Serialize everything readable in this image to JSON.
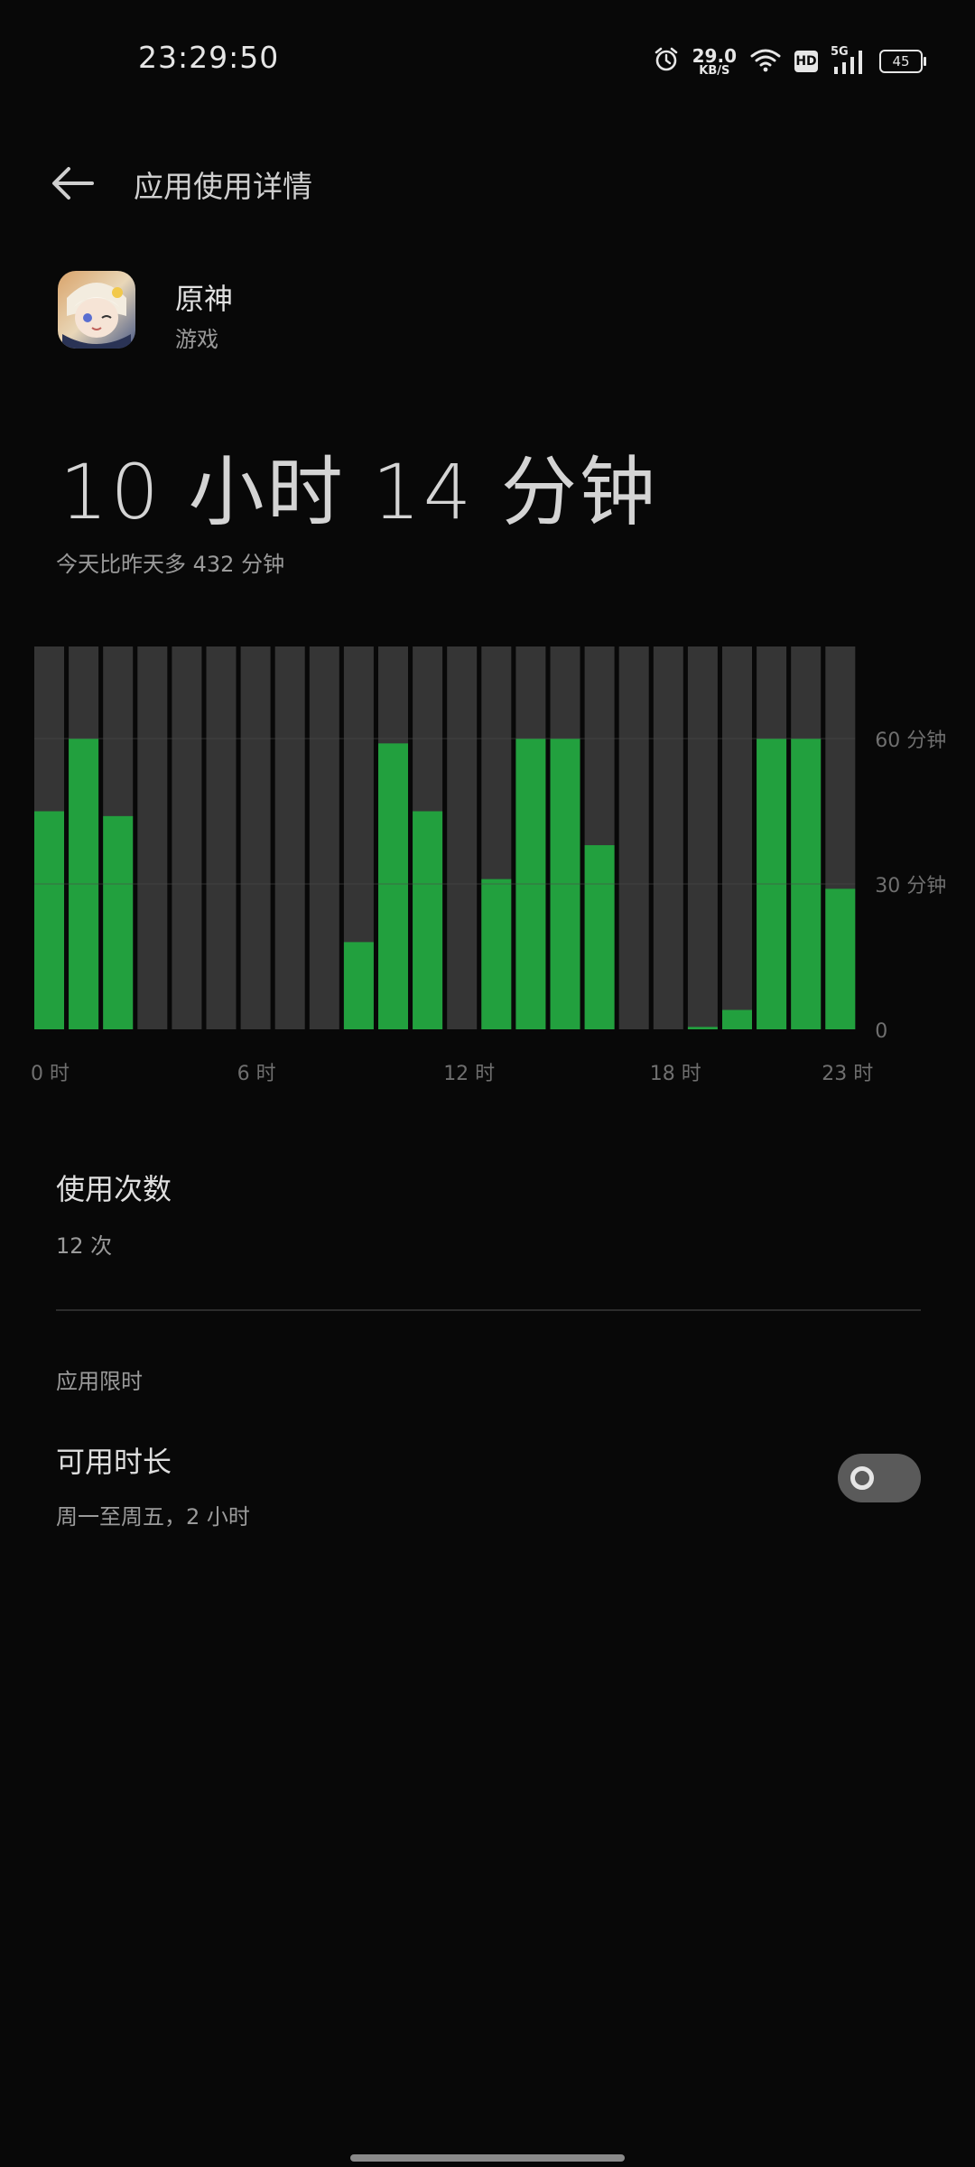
{
  "status_bar": {
    "time": "23:29:50",
    "net_speed_value": "29.0",
    "net_speed_unit": "KB/S",
    "hd_label": "HD",
    "network_label": "5G",
    "battery_level": "45"
  },
  "header": {
    "title": "应用使用详情"
  },
  "app": {
    "name": "原神",
    "category": "游戏"
  },
  "summary": {
    "total_time": "10 小时 14 分钟",
    "comparison": "今天比昨天多 432 分钟"
  },
  "chart_data": {
    "type": "bar",
    "categories": [
      "0",
      "1",
      "2",
      "3",
      "4",
      "5",
      "6",
      "7",
      "8",
      "9",
      "10",
      "11",
      "12",
      "13",
      "14",
      "15",
      "16",
      "17",
      "18",
      "19",
      "20",
      "21",
      "22",
      "23"
    ],
    "values": [
      45,
      60,
      44,
      0,
      0,
      0,
      0,
      0,
      0,
      18,
      59,
      45,
      0,
      31,
      60,
      60,
      38,
      0,
      0,
      0.5,
      4,
      60,
      60,
      29
    ],
    "max_value": 79,
    "ylim": [
      0,
      79
    ],
    "y_ticks": [
      {
        "value": 0,
        "label": "0"
      },
      {
        "value": 30,
        "label": "30 分钟"
      },
      {
        "value": 60,
        "label": "60 分钟"
      }
    ],
    "x_ticks": [
      {
        "index": 0,
        "label": "0 时"
      },
      {
        "index": 6,
        "label": "6 时"
      },
      {
        "index": 12,
        "label": "12 时"
      },
      {
        "index": 18,
        "label": "18 时"
      },
      {
        "index": 23,
        "label": "23 时"
      }
    ],
    "bar_color": "#22a03e",
    "track_color": "#353535",
    "grid": true
  },
  "usage_count": {
    "title": "使用次数",
    "value": "12 次"
  },
  "app_limit": {
    "section_label": "应用限时",
    "title": "可用时长",
    "description": "周一至周五，2 小时",
    "enabled": false
  }
}
